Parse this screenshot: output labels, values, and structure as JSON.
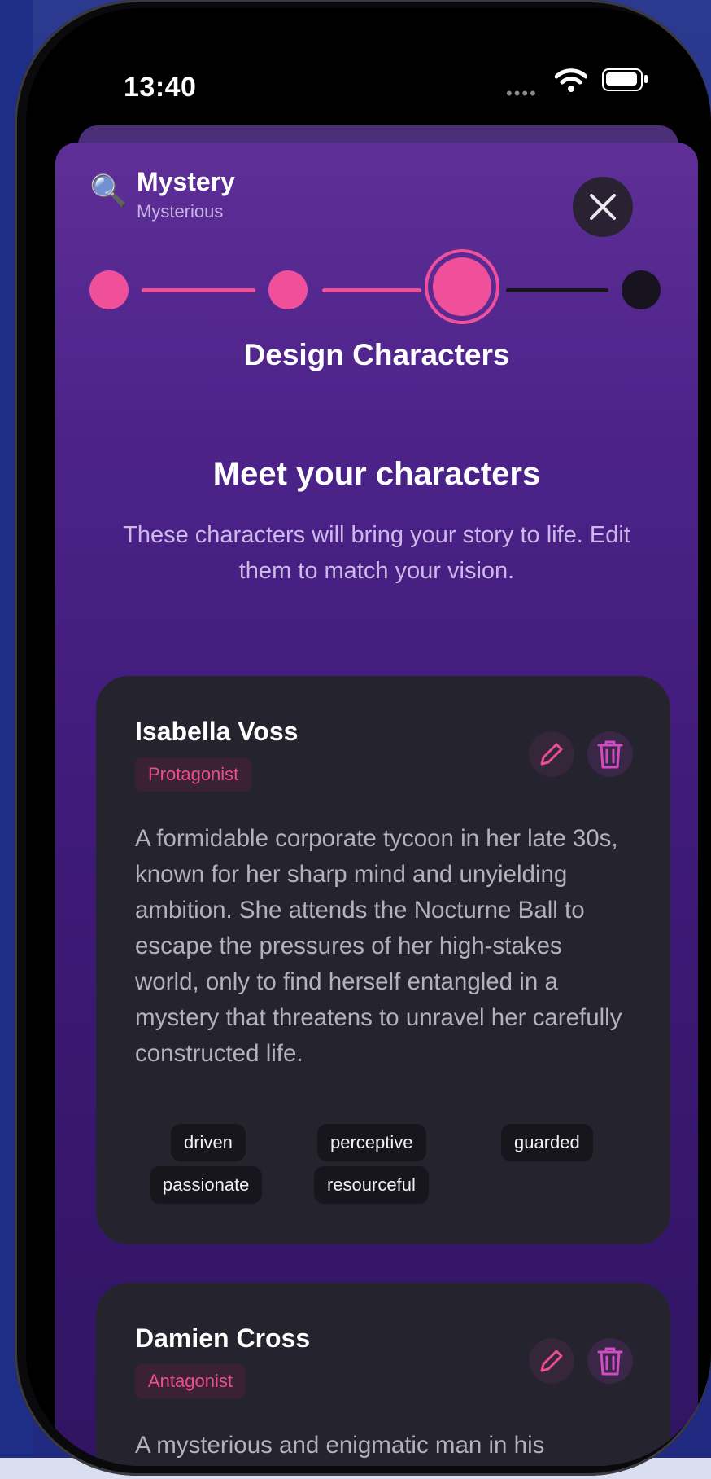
{
  "status": {
    "time": "13:40"
  },
  "header": {
    "icon": "magnifying-glass",
    "title": "Mystery",
    "subtitle": "Mysterious"
  },
  "stepper": {
    "current_step": 3,
    "total_steps": 4
  },
  "step_label": "Design Characters",
  "intro": {
    "title": "Meet your characters",
    "subtitle": "These characters will bring your story to life. Edit them to match your vision."
  },
  "characters": [
    {
      "name": "Isabella Voss",
      "role": "Protagonist",
      "description": "A formidable corporate tycoon in her late 30s, known for her sharp mind and unyielding ambition. She attends the Nocturne Ball to escape the pressures of her high-stakes world, only to find herself entangled in a mystery that threatens to unravel her carefully constructed life.",
      "traits": [
        "driven",
        "perceptive",
        "guarded",
        "passionate",
        "resourceful"
      ]
    },
    {
      "name": "Damien Cross",
      "role": "Antagonist",
      "description": "A mysterious and enigmatic man in his"
    }
  ],
  "colors": {
    "accent": "#f0509a",
    "card": "#25232e",
    "sheet_top": "#5e2f97"
  }
}
